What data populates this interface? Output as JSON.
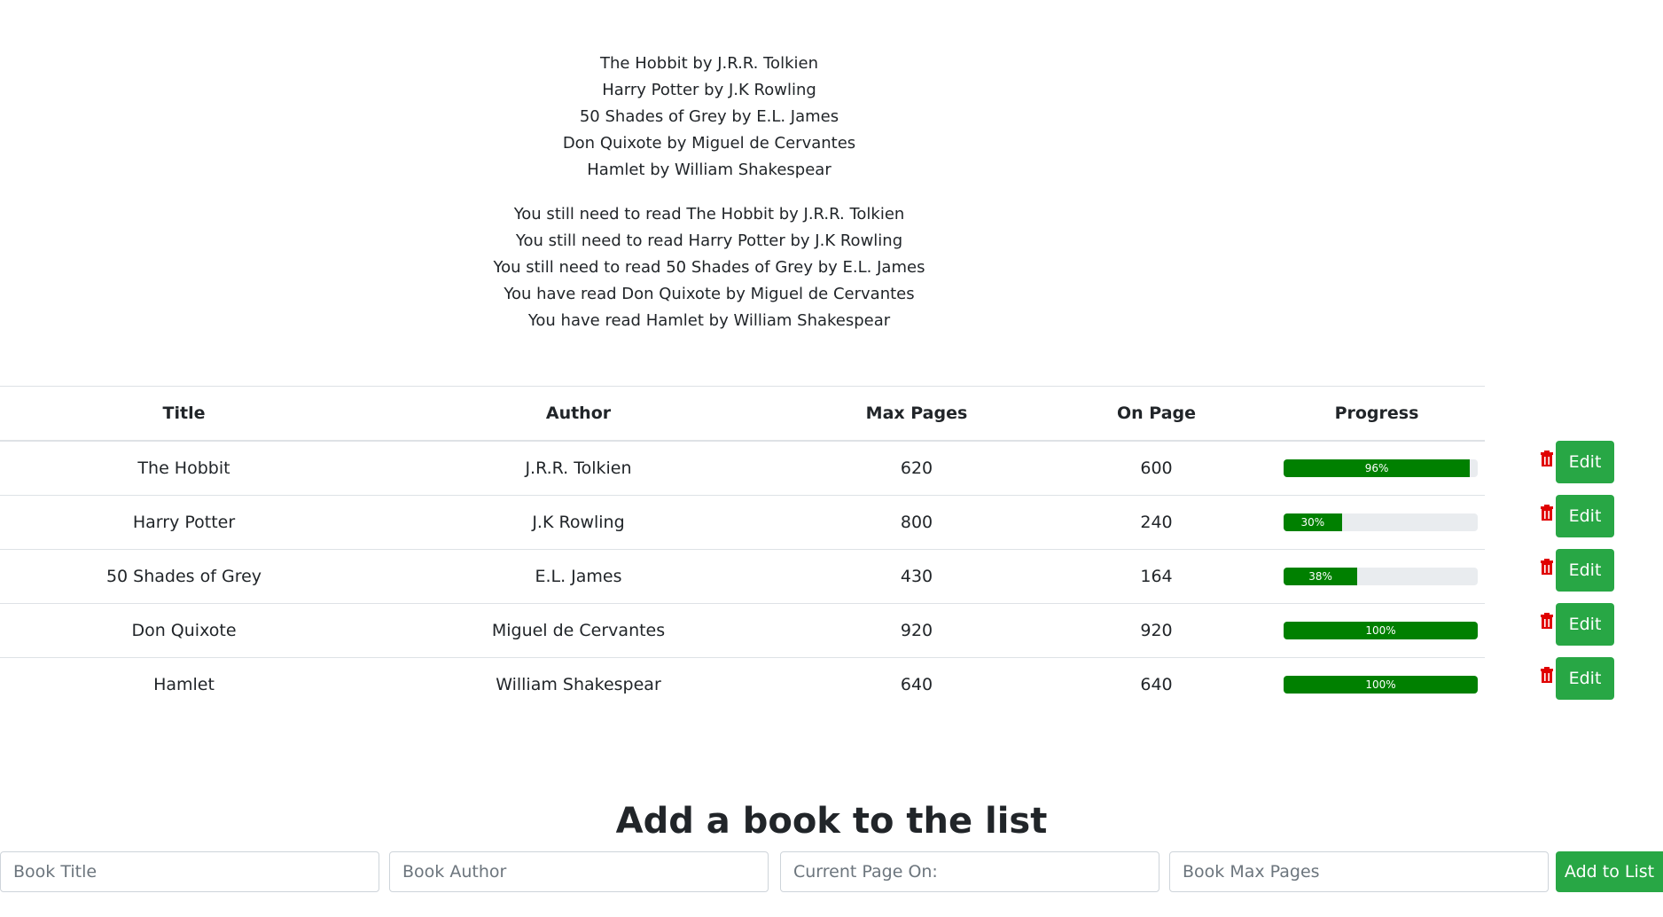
{
  "book_list": [
    "The Hobbit by J.R.R. Tolkien",
    "Harry Potter by J.K Rowling",
    "50 Shades of Grey by E.L. James",
    "Don Quixote by Miguel de Cervantes",
    "Hamlet by William Shakespear"
  ],
  "status_list": [
    "You still need to read The Hobbit by J.R.R. Tolkien",
    "You still need to read Harry Potter by J.K Rowling",
    "You still need to read 50 Shades of Grey by E.L. James",
    "You have read Don Quixote by Miguel de Cervantes",
    "You have read Hamlet by William Shakespear"
  ],
  "table": {
    "headers": {
      "title": "Title",
      "author": "Author",
      "max_pages": "Max Pages",
      "on_page": "On Page",
      "progress": "Progress"
    },
    "rows": [
      {
        "title": "The Hobbit",
        "author": "J.R.R. Tolkien",
        "max_pages": "620",
        "on_page": "600",
        "progress_label": "96%",
        "progress": 96
      },
      {
        "title": "Harry Potter",
        "author": "J.K Rowling",
        "max_pages": "800",
        "on_page": "240",
        "progress_label": "30%",
        "progress": 30
      },
      {
        "title": "50 Shades of Grey",
        "author": "E.L. James",
        "max_pages": "430",
        "on_page": "164",
        "progress_label": "38%",
        "progress": 38
      },
      {
        "title": "Don Quixote",
        "author": "Miguel de Cervantes",
        "max_pages": "920",
        "on_page": "920",
        "progress_label": "100%",
        "progress": 100
      },
      {
        "title": "Hamlet",
        "author": "William Shakespear",
        "max_pages": "640",
        "on_page": "640",
        "progress_label": "100%",
        "progress": 100
      }
    ],
    "edit_label": "Edit"
  },
  "add_form": {
    "heading": "Add a book to the list",
    "title_placeholder": "Book Title",
    "author_placeholder": "Book Author",
    "current_page_placeholder": "Current Page On:",
    "max_pages_placeholder": "Book Max Pages",
    "submit_label": "Add to List"
  },
  "colors": {
    "progress_fill": "#008000",
    "progress_track": "#e9ecef",
    "button_green": "#28a745",
    "trash_red": "#e00000"
  },
  "icons": {
    "delete": "trash-icon"
  }
}
